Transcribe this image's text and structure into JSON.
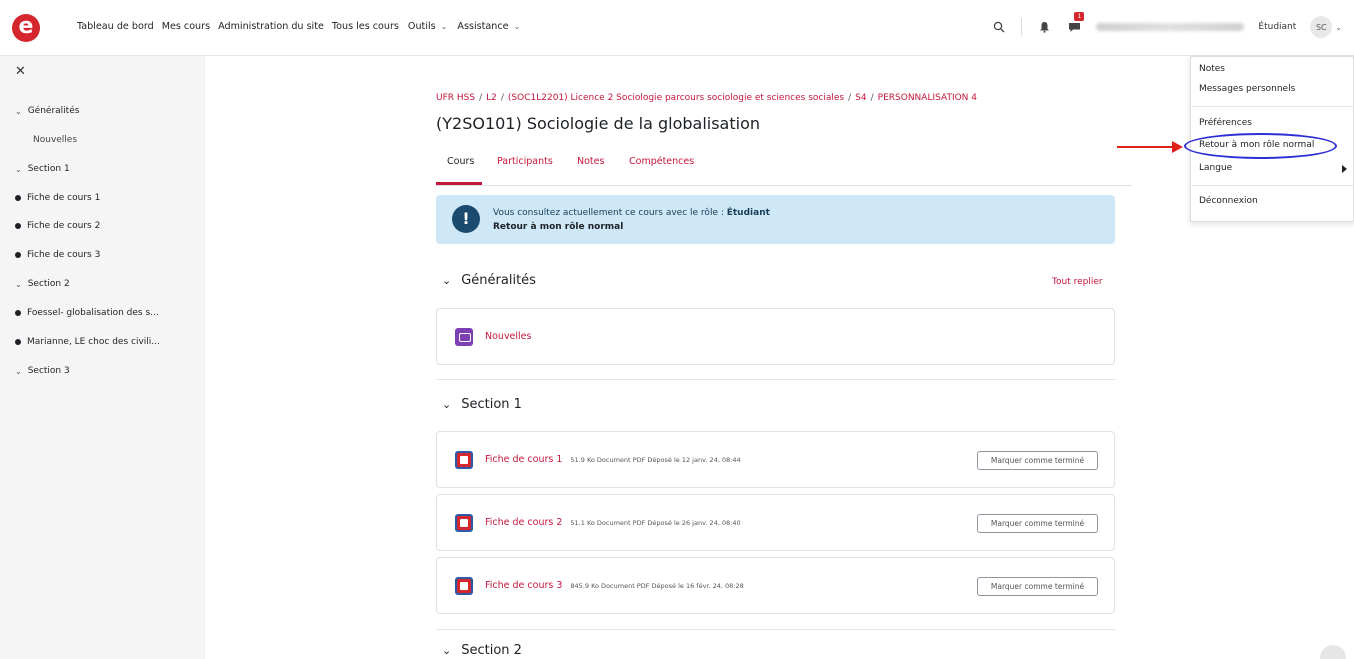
{
  "nav": {
    "links": [
      {
        "label": "Tableau de bord",
        "dropdown": false
      },
      {
        "label": "Mes cours",
        "dropdown": false
      },
      {
        "label": "Administration du site",
        "dropdown": false
      },
      {
        "label": "Tous les cours",
        "dropdown": false
      },
      {
        "label": "Outils",
        "dropdown": true
      },
      {
        "label": "Assistance",
        "dropdown": true
      }
    ],
    "notification_count": "1",
    "role": "Étudiant",
    "avatar_initials": "SC"
  },
  "sidebar": {
    "items": [
      {
        "label": "Généralités",
        "type": "section"
      },
      {
        "label": "Nouvelles",
        "type": "activity-plain"
      },
      {
        "label": "Section 1",
        "type": "section"
      },
      {
        "label": "Fiche de cours 1",
        "type": "activity"
      },
      {
        "label": "Fiche de cours 2",
        "type": "activity"
      },
      {
        "label": "Fiche de cours 3",
        "type": "activity"
      },
      {
        "label": "Section 2",
        "type": "section"
      },
      {
        "label": "Foessel- globalisation des s...",
        "type": "activity"
      },
      {
        "label": "Marianne, LE choc des civili...",
        "type": "activity"
      },
      {
        "label": "Section 3",
        "type": "section"
      }
    ]
  },
  "breadcrumb": [
    "UFR HSS",
    "L2",
    "(SOC1L2201) Licence 2 Sociologie parcours sociologie et sciences sociales",
    "S4",
    "PERSONNALISATION 4"
  ],
  "page_title": "(Y2SO101) Sociologie de la globalisation",
  "tabs": [
    "Cours",
    "Participants",
    "Notes",
    "Compétences"
  ],
  "alert": {
    "text": "Vous consultez actuellement ce cours avec le rôle : ",
    "role": "Étudiant",
    "link": "Retour à mon rôle normal"
  },
  "collapse_all": "Tout replier",
  "sections": [
    {
      "title": "Généralités"
    },
    {
      "title": "Section 1"
    },
    {
      "title": "Section 2"
    }
  ],
  "activities": [
    {
      "name": "Nouvelles",
      "meta": "",
      "button": ""
    },
    {
      "name": "Fiche de cours 1",
      "meta": "51.9 Ko Document PDF Déposé le 12 janv. 24, 08:44",
      "button": "Marquer comme terminé"
    },
    {
      "name": "Fiche de cours 2",
      "meta": "51.1 Ko Document PDF Déposé le 26 janv. 24, 08:40",
      "button": "Marquer comme terminé"
    },
    {
      "name": "Fiche de cours 3",
      "meta": "845.9 Ko Document PDF Déposé le 16 févr. 24, 08:28",
      "button": "Marquer comme terminé"
    }
  ],
  "user_menu": {
    "items": [
      "Notes",
      "Messages personnels",
      "Préférences",
      "Retour à mon rôle normal",
      "Langue",
      "Déconnexion"
    ]
  },
  "colors": {
    "brand": "#d4262c",
    "link": "#c5173c",
    "alert_bg": "#cfe8f7",
    "annotation_ellipse": "#2d2fd6",
    "annotation_arrow": "#e0201a"
  }
}
